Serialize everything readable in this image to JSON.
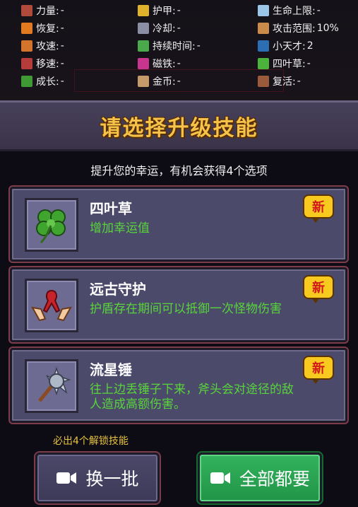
{
  "stats": [
    {
      "label": "力量:",
      "value": "-"
    },
    {
      "label": "护甲:",
      "value": "-"
    },
    {
      "label": "生命上限:",
      "value": "-"
    },
    {
      "label": "恢复:",
      "value": "-"
    },
    {
      "label": "冷却:",
      "value": "-"
    },
    {
      "label": "攻击范围:",
      "value": "10%"
    },
    {
      "label": "攻速:",
      "value": "-"
    },
    {
      "label": "持续时间:",
      "value": "-"
    },
    {
      "label": "小天才:",
      "value": "2"
    },
    {
      "label": "移速:",
      "value": "-"
    },
    {
      "label": "磁铁:",
      "value": "-"
    },
    {
      "label": "四叶草:",
      "value": "-"
    },
    {
      "label": "成长:",
      "value": "-"
    },
    {
      "label": "金币:",
      "value": "-"
    },
    {
      "label": "复活:",
      "value": "-"
    }
  ],
  "header": {
    "title": "请选择升级技能"
  },
  "subtitle": "提升您的幸运，有机会获得4个选项",
  "skills": [
    {
      "name": "四叶草",
      "desc": "增加幸运值",
      "badge": "新",
      "icon": "clover-icon"
    },
    {
      "name": "远古守护",
      "desc": "护盾存在期间可以抵御一次怪物伤害",
      "badge": "新",
      "icon": "ribbon-hands-icon"
    },
    {
      "name": "流星锤",
      "desc": "往上边丢锤子下来，斧头会对途径的敌人造成高额伤害。",
      "badge": "新",
      "icon": "mace-icon"
    }
  ],
  "footer": {
    "must_text": "必出4个解锁技能",
    "refresh_label": "换一批",
    "take_all_label": "全部都要"
  },
  "colors": {
    "title": "#f6c34a",
    "desc": "#59d43a",
    "badge": "#f8c91f",
    "green_button": "#2aa551"
  }
}
